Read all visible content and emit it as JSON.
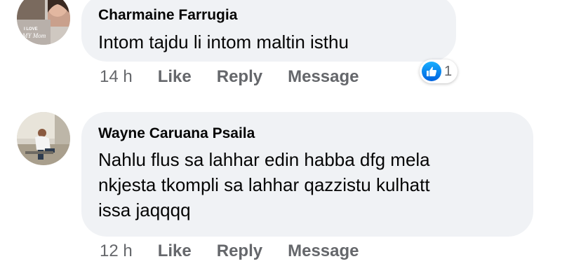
{
  "comments": [
    {
      "author": "Charmaine Farrugia",
      "avatar_label": "I LOVE MY Mom",
      "text_lines": [
        "Intom  tajdu  li  intom  maltin isthu"
      ],
      "time": "14 h",
      "like_label": "Like",
      "reply_label": "Reply",
      "message_label": "Message",
      "reaction_icon": "thumbs-up-icon",
      "reaction_count": "1"
    },
    {
      "author": "Wayne Caruana Psaila",
      "text_lines": [
        "Nahlu flus sa lahhar edin habba dfg mela",
        "nkjesta tkompli sa lahhar qazzistu kulhatt",
        "issa jaqqqq"
      ],
      "time": "12 h",
      "like_label": "Like",
      "reply_label": "Reply",
      "message_label": "Message"
    }
  ],
  "colors": {
    "bubble": "#f0f2f5",
    "text": "#050505",
    "secondary": "#65676b",
    "like_blue": "#0062df"
  }
}
